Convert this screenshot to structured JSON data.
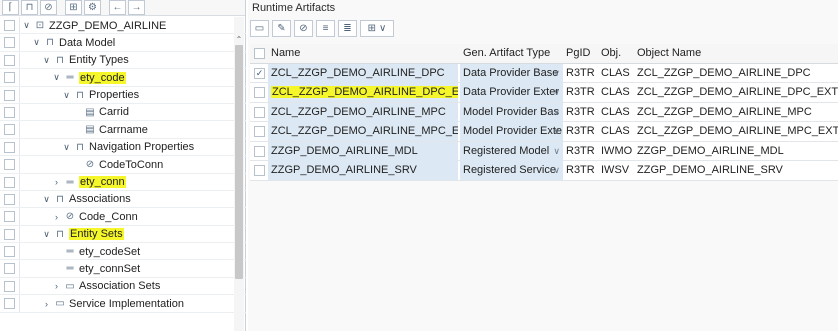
{
  "left_pane": {
    "tree": [
      {
        "label": "ZZGP_DEMO_AIRLINE",
        "level": 0,
        "toggle": "∨",
        "icon": "project-icon",
        "highlight": false
      },
      {
        "label": "Data Model",
        "level": 1,
        "toggle": "∨",
        "icon": "folder-open-icon",
        "highlight": false
      },
      {
        "label": "Entity Types",
        "level": 2,
        "toggle": "∨",
        "icon": "folder-open-icon",
        "highlight": false
      },
      {
        "label": "ety_code",
        "level": 3,
        "toggle": "∨",
        "icon": "entity-icon",
        "highlight": true
      },
      {
        "label": "Properties",
        "level": 4,
        "toggle": "∨",
        "icon": "folder-open-icon",
        "highlight": false
      },
      {
        "label": "Carrid",
        "level": 5,
        "toggle": "",
        "icon": "property-icon",
        "highlight": false
      },
      {
        "label": "Carrname",
        "level": 5,
        "toggle": "",
        "icon": "property-icon",
        "highlight": false
      },
      {
        "label": "Navigation Properties",
        "level": 4,
        "toggle": "∨",
        "icon": "folder-open-icon",
        "highlight": false
      },
      {
        "label": "CodeToConn",
        "level": 5,
        "toggle": "",
        "icon": "link-icon",
        "highlight": false
      },
      {
        "label": "ety_conn",
        "level": 3,
        "toggle": "›",
        "icon": "entity-icon",
        "highlight": true
      },
      {
        "label": "Associations",
        "level": 2,
        "toggle": "∨",
        "icon": "folder-open-icon",
        "highlight": false
      },
      {
        "label": "Code_Conn",
        "level": 3,
        "toggle": "›",
        "icon": "link-icon",
        "highlight": false
      },
      {
        "label": "Entity Sets",
        "level": 2,
        "toggle": "∨",
        "icon": "folder-open-icon",
        "highlight": true
      },
      {
        "label": "ety_codeSet",
        "level": 3,
        "toggle": "",
        "icon": "entity-icon",
        "highlight": false
      },
      {
        "label": "ety_connSet",
        "level": 3,
        "toggle": "",
        "icon": "entity-icon",
        "highlight": false
      },
      {
        "label": "Association Sets",
        "level": 3,
        "toggle": "›",
        "icon": "folder-icon",
        "highlight": false
      },
      {
        "label": "Service Implementation",
        "level": 2,
        "toggle": "›",
        "icon": "folder-icon",
        "highlight": false
      }
    ]
  },
  "right_pane": {
    "title": "Runtime Artifacts",
    "columns": [
      "Name",
      "Gen. Artifact Type",
      "PgID",
      "Obj.",
      "Object Name"
    ],
    "rows": [
      {
        "name": "ZCL_ZZGP_DEMO_AIRLINE_DPC",
        "gen": "Data Provider Base",
        "pgid": "R3TR",
        "obj": "CLAS",
        "oname": "ZCL_ZZGP_DEMO_AIRLINE_DPC",
        "checked": true,
        "highlight": false
      },
      {
        "name": "ZCL_ZZGP_DEMO_AIRLINE_DPC_EXT",
        "gen": "Data Provider Exter",
        "pgid": "R3TR",
        "obj": "CLAS",
        "oname": "ZCL_ZZGP_DEMO_AIRLINE_DPC_EXT",
        "checked": false,
        "highlight": true
      },
      {
        "name": "ZCL_ZZGP_DEMO_AIRLINE_MPC",
        "gen": "Model Provider Bas",
        "pgid": "R3TR",
        "obj": "CLAS",
        "oname": "ZCL_ZZGP_DEMO_AIRLINE_MPC",
        "checked": false,
        "highlight": false
      },
      {
        "name": "ZCL_ZZGP_DEMO_AIRLINE_MPC_EXT",
        "gen": "Model Provider Exte",
        "pgid": "R3TR",
        "obj": "CLAS",
        "oname": "ZCL_ZZGP_DEMO_AIRLINE_MPC_EXT",
        "checked": false,
        "highlight": false
      },
      {
        "name": "ZZGP_DEMO_AIRLINE_MDL",
        "gen": "Registered Model",
        "pgid": "R3TR",
        "obj": "IWMO",
        "oname": "ZZGP_DEMO_AIRLINE_MDL",
        "checked": false,
        "highlight": false
      },
      {
        "name": "ZZGP_DEMO_AIRLINE_SRV",
        "gen": "Registered Service",
        "pgid": "R3TR",
        "obj": "IWSV",
        "oname": "ZZGP_DEMO_AIRLINE_SRV",
        "checked": false,
        "highlight": false
      }
    ]
  },
  "colors": {
    "highlight": "#f6f72a",
    "selected_cell": "#dce8f3",
    "icon": "#5b6f85"
  }
}
